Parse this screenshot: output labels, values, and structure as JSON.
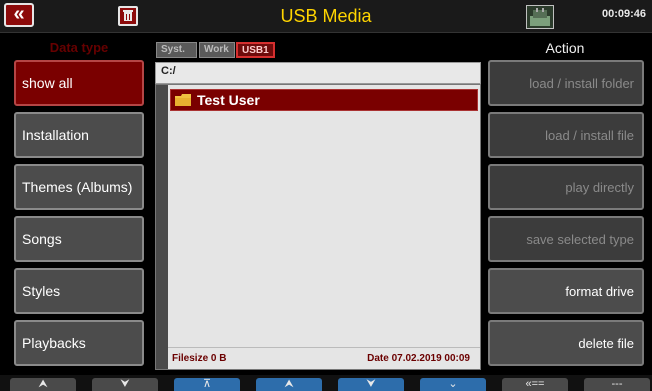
{
  "header": {
    "back_label": "«",
    "title": "USB Media",
    "time": "00:09:46"
  },
  "left": {
    "heading": "Data type",
    "items": [
      {
        "label": "show all",
        "active": true
      },
      {
        "label": "Installation",
        "active": false
      },
      {
        "label": "Themes (Albums)",
        "active": false
      },
      {
        "label": "Songs",
        "active": false
      },
      {
        "label": "Styles",
        "active": false
      },
      {
        "label": "Playbacks",
        "active": false
      }
    ]
  },
  "center": {
    "tabs": [
      "Syst.",
      "Work",
      "USB1"
    ],
    "active_tab": "USB1",
    "path": "C:/",
    "files": [
      {
        "name": "Test User",
        "type": "folder",
        "selected": true
      }
    ],
    "filesize": "Filesize 0 B",
    "date": "Date 07.02.2019  00:09"
  },
  "right": {
    "heading": "Action",
    "actions": [
      {
        "label": "load  /  install folder",
        "enabled": false
      },
      {
        "label": "load  /  install file",
        "enabled": false
      },
      {
        "label": "play directly",
        "enabled": false
      },
      {
        "label": "save selected type",
        "enabled": false
      },
      {
        "label": "format drive",
        "enabled": true
      },
      {
        "label": "delete file",
        "enabled": true
      }
    ]
  },
  "bottom": {
    "buttons": [
      {
        "label": "⮝",
        "icon": "double-up-icon"
      },
      {
        "label": "⮟",
        "icon": "double-down-icon"
      },
      {
        "label": "⊼",
        "icon": "top-icon"
      },
      {
        "label": "⮝",
        "icon": "double-up-icon"
      },
      {
        "label": "⮟",
        "icon": "double-down-icon"
      },
      {
        "label": "⌄",
        "icon": "down-icon"
      },
      {
        "label": "«==",
        "icon": "back-level-icon"
      },
      {
        "label": "---",
        "icon": "none"
      }
    ]
  },
  "colors": {
    "accent_red": "#7a0000",
    "title_yellow": "#ffd400",
    "bottom_blue": "#2d6dab"
  }
}
